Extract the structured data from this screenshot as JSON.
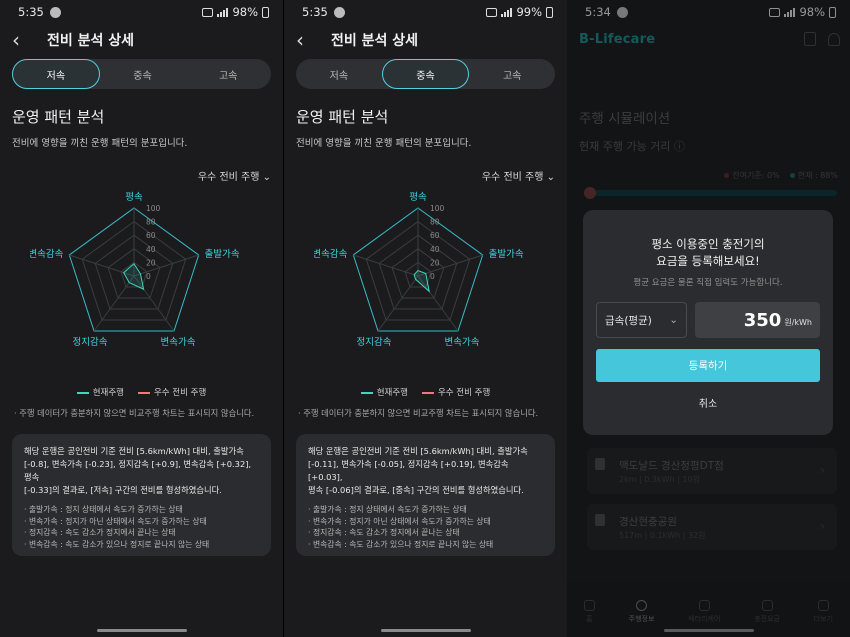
{
  "colors": {
    "accent": "#4fd1e0",
    "current_series": "#3fd6c0",
    "good_series": "#f2787a",
    "button": "#45c6da"
  },
  "screens": [
    {
      "status": {
        "time": "5:35",
        "battery": "98%"
      },
      "title": "전비 분석 상세",
      "tabs": [
        "저속",
        "중속",
        "고속"
      ],
      "active_tab": 0,
      "section_title": "운영 패턴 분석",
      "section_desc": "전비에 영향을 끼친 운행 패턴의 분포입니다.",
      "dropdown": "우수 전비 주행",
      "chart_data": {
        "type": "radar",
        "axes": [
          "평속",
          "출발가속",
          "변속가속",
          "정지감속",
          "변속감속"
        ],
        "ticks": [
          0,
          20,
          40,
          60,
          80,
          100
        ],
        "rlim": [
          0,
          100
        ],
        "series": [
          {
            "name": "현재주행",
            "values": [
              18,
              10,
              24,
              12,
              16
            ]
          },
          {
            "name": "우수 전비 주행",
            "values": [
              0,
              0,
              0,
              0,
              0
            ]
          }
        ]
      },
      "legend": [
        "현재주행",
        "우수 전비 주행"
      ],
      "note": "· 주행 데이터가 충분하지 않으면 비교주행 차트는 표시되지 않습니다.",
      "summary_lines": [
        "해당 운행은 공인전비 기준 전비 [5.6km/kWh] 대비, 출발가속",
        "[-0.8], 변속가속 [-0.23], 정지감속 [+0.9], 변속감속 [+0.32], 평속",
        "[-0.33]의 결과로, [저속] 구간의 전비를 형성하였습니다."
      ],
      "definitions": [
        "· 출발가속 : 정지 상태에서 속도가 증가하는 상태",
        "· 변속가속 : 정지가 아닌 상태에서 속도가 증가하는 상태",
        "· 정지감속 : 속도 감소가 정지에서 끝나는 상태",
        "· 변속감속 : 속도 감소가 있으나 정지로 끝나지 않는 상태"
      ]
    },
    {
      "status": {
        "time": "5:35",
        "battery": "99%"
      },
      "title": "전비 분석 상세",
      "tabs": [
        "저속",
        "중속",
        "고속"
      ],
      "active_tab": 1,
      "section_title": "운영 패턴 분석",
      "section_desc": "전비에 영향을 끼친 운행 패턴의 분포입니다.",
      "dropdown": "우수 전비 주행",
      "chart_data": {
        "type": "radar",
        "axes": [
          "평속",
          "출발가속",
          "변속가속",
          "정지감속",
          "변속감속"
        ],
        "ticks": [
          0,
          20,
          40,
          60,
          80,
          100
        ],
        "rlim": [
          0,
          100
        ],
        "series": [
          {
            "name": "현재주행",
            "values": [
              8,
              12,
              28,
              6,
              6
            ]
          },
          {
            "name": "우수 전비 주행",
            "values": [
              0,
              0,
              0,
              0,
              0
            ]
          }
        ]
      },
      "legend": [
        "현재주행",
        "우수 전비 주행"
      ],
      "note": "· 주행 데이터가 충분하지 않으면 비교주행 차트는 표시되지 않습니다.",
      "summary_lines": [
        "해당 운행은 공인전비 기준 전비 [5.6km/kWh] 대비, 출발가속",
        "[-0.11], 변속가속 [-0.05], 정지감속 [+0.19], 변속감속 [+0.03],",
        "평속 [-0.06]의 결과로, [중속] 구간의 전비를 형성하였습니다."
      ],
      "definitions": [
        "· 출발가속 : 정지 상태에서 속도가 증가하는 상태",
        "· 변속가속 : 정지가 아닌 상태에서 속도가 증가하는 상태",
        "· 정지감속 : 속도 감소가 정지에서 끝나는 상태",
        "· 변속감속 : 속도 감소가 있으나 정지로 끝나지 않는 상태"
      ]
    }
  ],
  "lifecare": {
    "status": {
      "time": "5:34",
      "battery": "98%"
    },
    "logo": "B-Lifecare",
    "bg_title": "주행 시뮬레이션",
    "bg_sub": "현재 주행 가능 거리 ⓘ",
    "bg_legend": [
      "잔여기준: 0%",
      "현재 : 88%"
    ],
    "stations": [
      {
        "name": "맥도날드 경산정평DT점",
        "sub": "2km | 0.3kWh | 10원"
      },
      {
        "name": "경산현충공원",
        "sub": "517m | 0.1kWh | 32원"
      }
    ],
    "nav": [
      "홈",
      "주행정보",
      "배터리케어",
      "충전요금",
      "더보기"
    ],
    "nav_selected": 1,
    "modal": {
      "title_line1": "평소 이용중인 충전기의",
      "title_line2": "요금을 등록해보세요!",
      "sub": "평균 요금은 물론 직접 입력도 가능합니다.",
      "select_value": "급속(평균)",
      "price": "350",
      "unit": "원/kWh",
      "register": "등록하기",
      "cancel": "취소"
    }
  }
}
